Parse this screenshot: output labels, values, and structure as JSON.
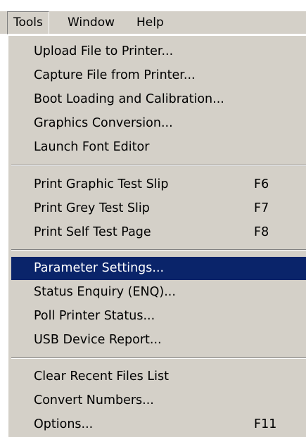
{
  "menubar": {
    "items": [
      {
        "label": "Tools",
        "active": true
      },
      {
        "label": "Window",
        "active": false
      },
      {
        "label": "Help",
        "active": false
      }
    ]
  },
  "tools_menu": {
    "group1": [
      {
        "label": "Upload File to Printer..."
      },
      {
        "label": "Capture File from Printer..."
      },
      {
        "label": "Boot Loading and Calibration..."
      },
      {
        "label": "Graphics Conversion..."
      },
      {
        "label": "Launch Font Editor"
      }
    ],
    "group2": [
      {
        "label": "Print Graphic Test Slip",
        "shortcut": "F6"
      },
      {
        "label": "Print Grey Test Slip",
        "shortcut": "F7"
      },
      {
        "label": "Print Self Test Page",
        "shortcut": "F8"
      }
    ],
    "group3": [
      {
        "label": "Parameter Settings...",
        "highlighted": true
      },
      {
        "label": "Status Enquiry (ENQ)..."
      },
      {
        "label": "Poll Printer Status..."
      },
      {
        "label": "USB Device Report..."
      }
    ],
    "group4": [
      {
        "label": "Clear Recent Files List"
      },
      {
        "label": "Convert Numbers..."
      },
      {
        "label": "Options...",
        "shortcut": "F11"
      }
    ]
  },
  "colors": {
    "menu_face": "#d4d0c8",
    "highlight": "#0a246a",
    "highlight_text": "#ffffff"
  }
}
